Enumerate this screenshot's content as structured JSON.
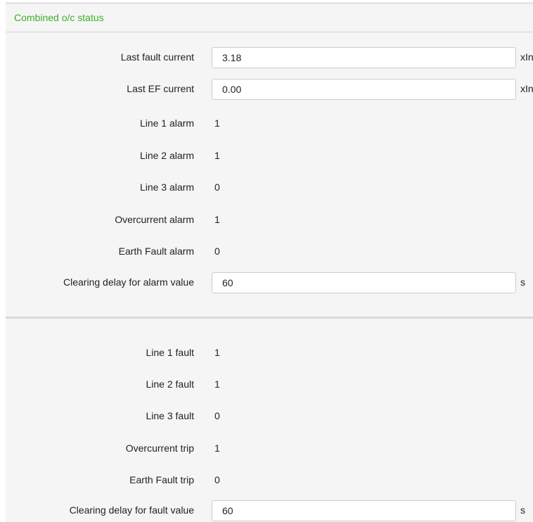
{
  "panel": {
    "title": "Combined o/c status"
  },
  "alarms": {
    "last_fault_current": {
      "label": "Last fault current",
      "value": "3.18",
      "unit": "xIn"
    },
    "last_ef_current": {
      "label": "Last EF current",
      "value": "0.00",
      "unit": "xIn"
    },
    "line1_alarm": {
      "label": "Line 1 alarm",
      "value": "1"
    },
    "line2_alarm": {
      "label": "Line 2 alarm",
      "value": "1"
    },
    "line3_alarm": {
      "label": "Line 3 alarm",
      "value": "0"
    },
    "overcurrent_alarm": {
      "label": "Overcurrent alarm",
      "value": "1"
    },
    "earth_fault_alarm": {
      "label": "Earth Fault alarm",
      "value": "0"
    },
    "clearing_delay_alarm": {
      "label": "Clearing delay for alarm value",
      "value": "60",
      "unit": "s"
    }
  },
  "faults": {
    "line1_fault": {
      "label": "Line 1 fault",
      "value": "1"
    },
    "line2_fault": {
      "label": "Line 2 fault",
      "value": "1"
    },
    "line3_fault": {
      "label": "Line 3 fault",
      "value": "0"
    },
    "overcurrent_trip": {
      "label": "Overcurrent trip",
      "value": "1"
    },
    "earth_fault_trip": {
      "label": "Earth Fault trip",
      "value": "0"
    },
    "clearing_delay_fault": {
      "label": "Clearing delay for fault value",
      "value": "60",
      "unit": "s"
    }
  }
}
